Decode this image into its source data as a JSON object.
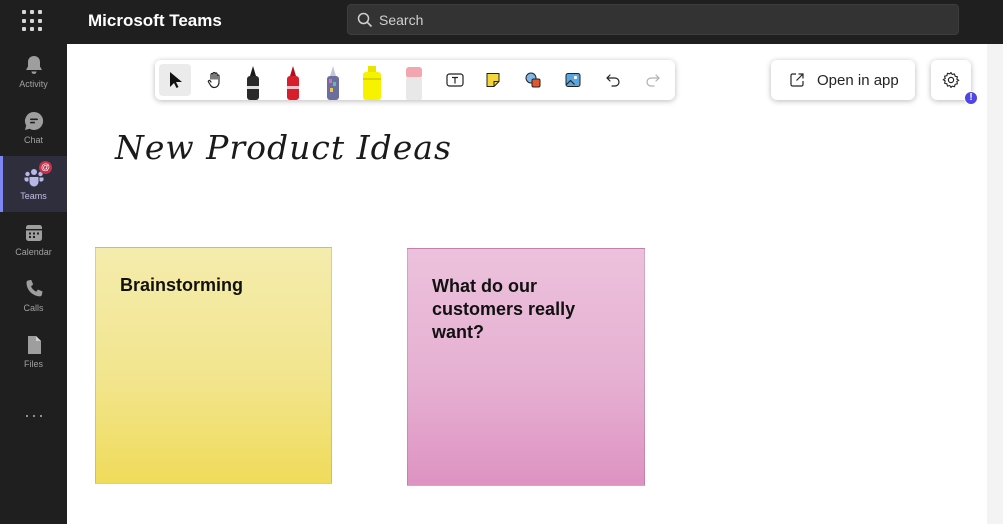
{
  "app": {
    "title": "Microsoft Teams"
  },
  "search": {
    "placeholder": "Search"
  },
  "rail": {
    "items": [
      {
        "label": "Activity",
        "icon": "bell-icon"
      },
      {
        "label": "Chat",
        "icon": "chat-icon"
      },
      {
        "label": "Teams",
        "icon": "teams-icon",
        "active": true,
        "badge": "@"
      },
      {
        "label": "Calendar",
        "icon": "calendar-icon"
      },
      {
        "label": "Calls",
        "icon": "phone-icon"
      },
      {
        "label": "Files",
        "icon": "file-icon"
      }
    ],
    "more": "···"
  },
  "toolbar": {
    "tools": [
      {
        "name": "select",
        "icon": "pointer-icon",
        "selected": true
      },
      {
        "name": "pan",
        "icon": "hand-icon"
      },
      {
        "name": "black-pen",
        "color": "#1a1a1a"
      },
      {
        "name": "red-pen",
        "color": "#d81e2c"
      },
      {
        "name": "rainbow-pen",
        "color": "#7a7aa0"
      },
      {
        "name": "highlighter",
        "color": "#f6f200"
      },
      {
        "name": "eraser",
        "color": "#f2a6b0"
      },
      {
        "name": "text",
        "icon": "text-box-icon"
      },
      {
        "name": "sticky-note",
        "icon": "sticky-note-icon"
      },
      {
        "name": "shapes",
        "icon": "shapes-icon"
      },
      {
        "name": "image",
        "icon": "image-icon"
      },
      {
        "name": "undo",
        "icon": "undo-icon"
      },
      {
        "name": "redo",
        "icon": "redo-icon"
      }
    ]
  },
  "open_in_app": {
    "label": "Open in app"
  },
  "settings": {
    "badge": "!"
  },
  "board": {
    "title": "New Product Ideas"
  },
  "notes": [
    {
      "text": "Brainstorming",
      "color": "#f2e58e"
    },
    {
      "text": "What do our customers really want?",
      "color": "#e6b0d2"
    }
  ]
}
